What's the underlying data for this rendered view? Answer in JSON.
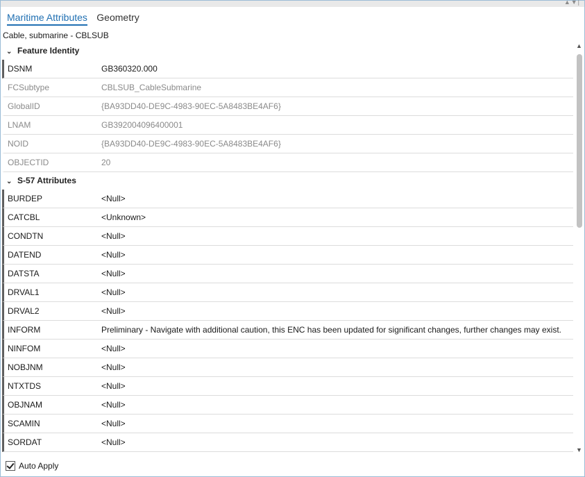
{
  "window": {
    "controls": "▲▼|"
  },
  "tabs": [
    {
      "label": "Maritime Attributes",
      "active": true
    },
    {
      "label": "Geometry",
      "active": false
    }
  ],
  "feature_title": "Cable, submarine - CBLSUB",
  "groups": {
    "identity": {
      "title": "Feature Identity",
      "rows": [
        {
          "name": "DSNM",
          "value": "GB360320.000"
        },
        {
          "name": "FCSubtype",
          "value": "CBLSUB_CableSubmarine"
        },
        {
          "name": "GlobalID",
          "value": "{BA93DD40-DE9C-4983-90EC-5A8483BE4AF6}"
        },
        {
          "name": "LNAM",
          "value": "GB392004096400001"
        },
        {
          "name": "NOID",
          "value": "{BA93DD40-DE9C-4983-90EC-5A8483BE4AF6}"
        },
        {
          "name": "OBJECTID",
          "value": "20"
        }
      ]
    },
    "s57": {
      "title": "S-57 Attributes",
      "rows": [
        {
          "name": "BURDEP",
          "value": "<Null>"
        },
        {
          "name": "CATCBL",
          "value": "<Unknown>"
        },
        {
          "name": "CONDTN",
          "value": "<Null>"
        },
        {
          "name": "DATEND",
          "value": "<Null>"
        },
        {
          "name": "DATSTA",
          "value": "<Null>"
        },
        {
          "name": "DRVAL1",
          "value": "<Null>"
        },
        {
          "name": "DRVAL2",
          "value": "<Null>"
        },
        {
          "name": "INFORM",
          "value": "Preliminary - Navigate with additional caution, this ENC has been updated for significant changes, further changes may exist."
        },
        {
          "name": "NINFOM",
          "value": "<Null>"
        },
        {
          "name": "NOBJNM",
          "value": "<Null>"
        },
        {
          "name": "NTXTDS",
          "value": "<Null>"
        },
        {
          "name": "OBJNAM",
          "value": "<Null>"
        },
        {
          "name": "SCAMIN",
          "value": "<Null>"
        },
        {
          "name": "SORDAT",
          "value": "<Null>"
        }
      ]
    }
  },
  "footer": {
    "auto_apply_label": "Auto Apply",
    "auto_apply_checked": true
  }
}
